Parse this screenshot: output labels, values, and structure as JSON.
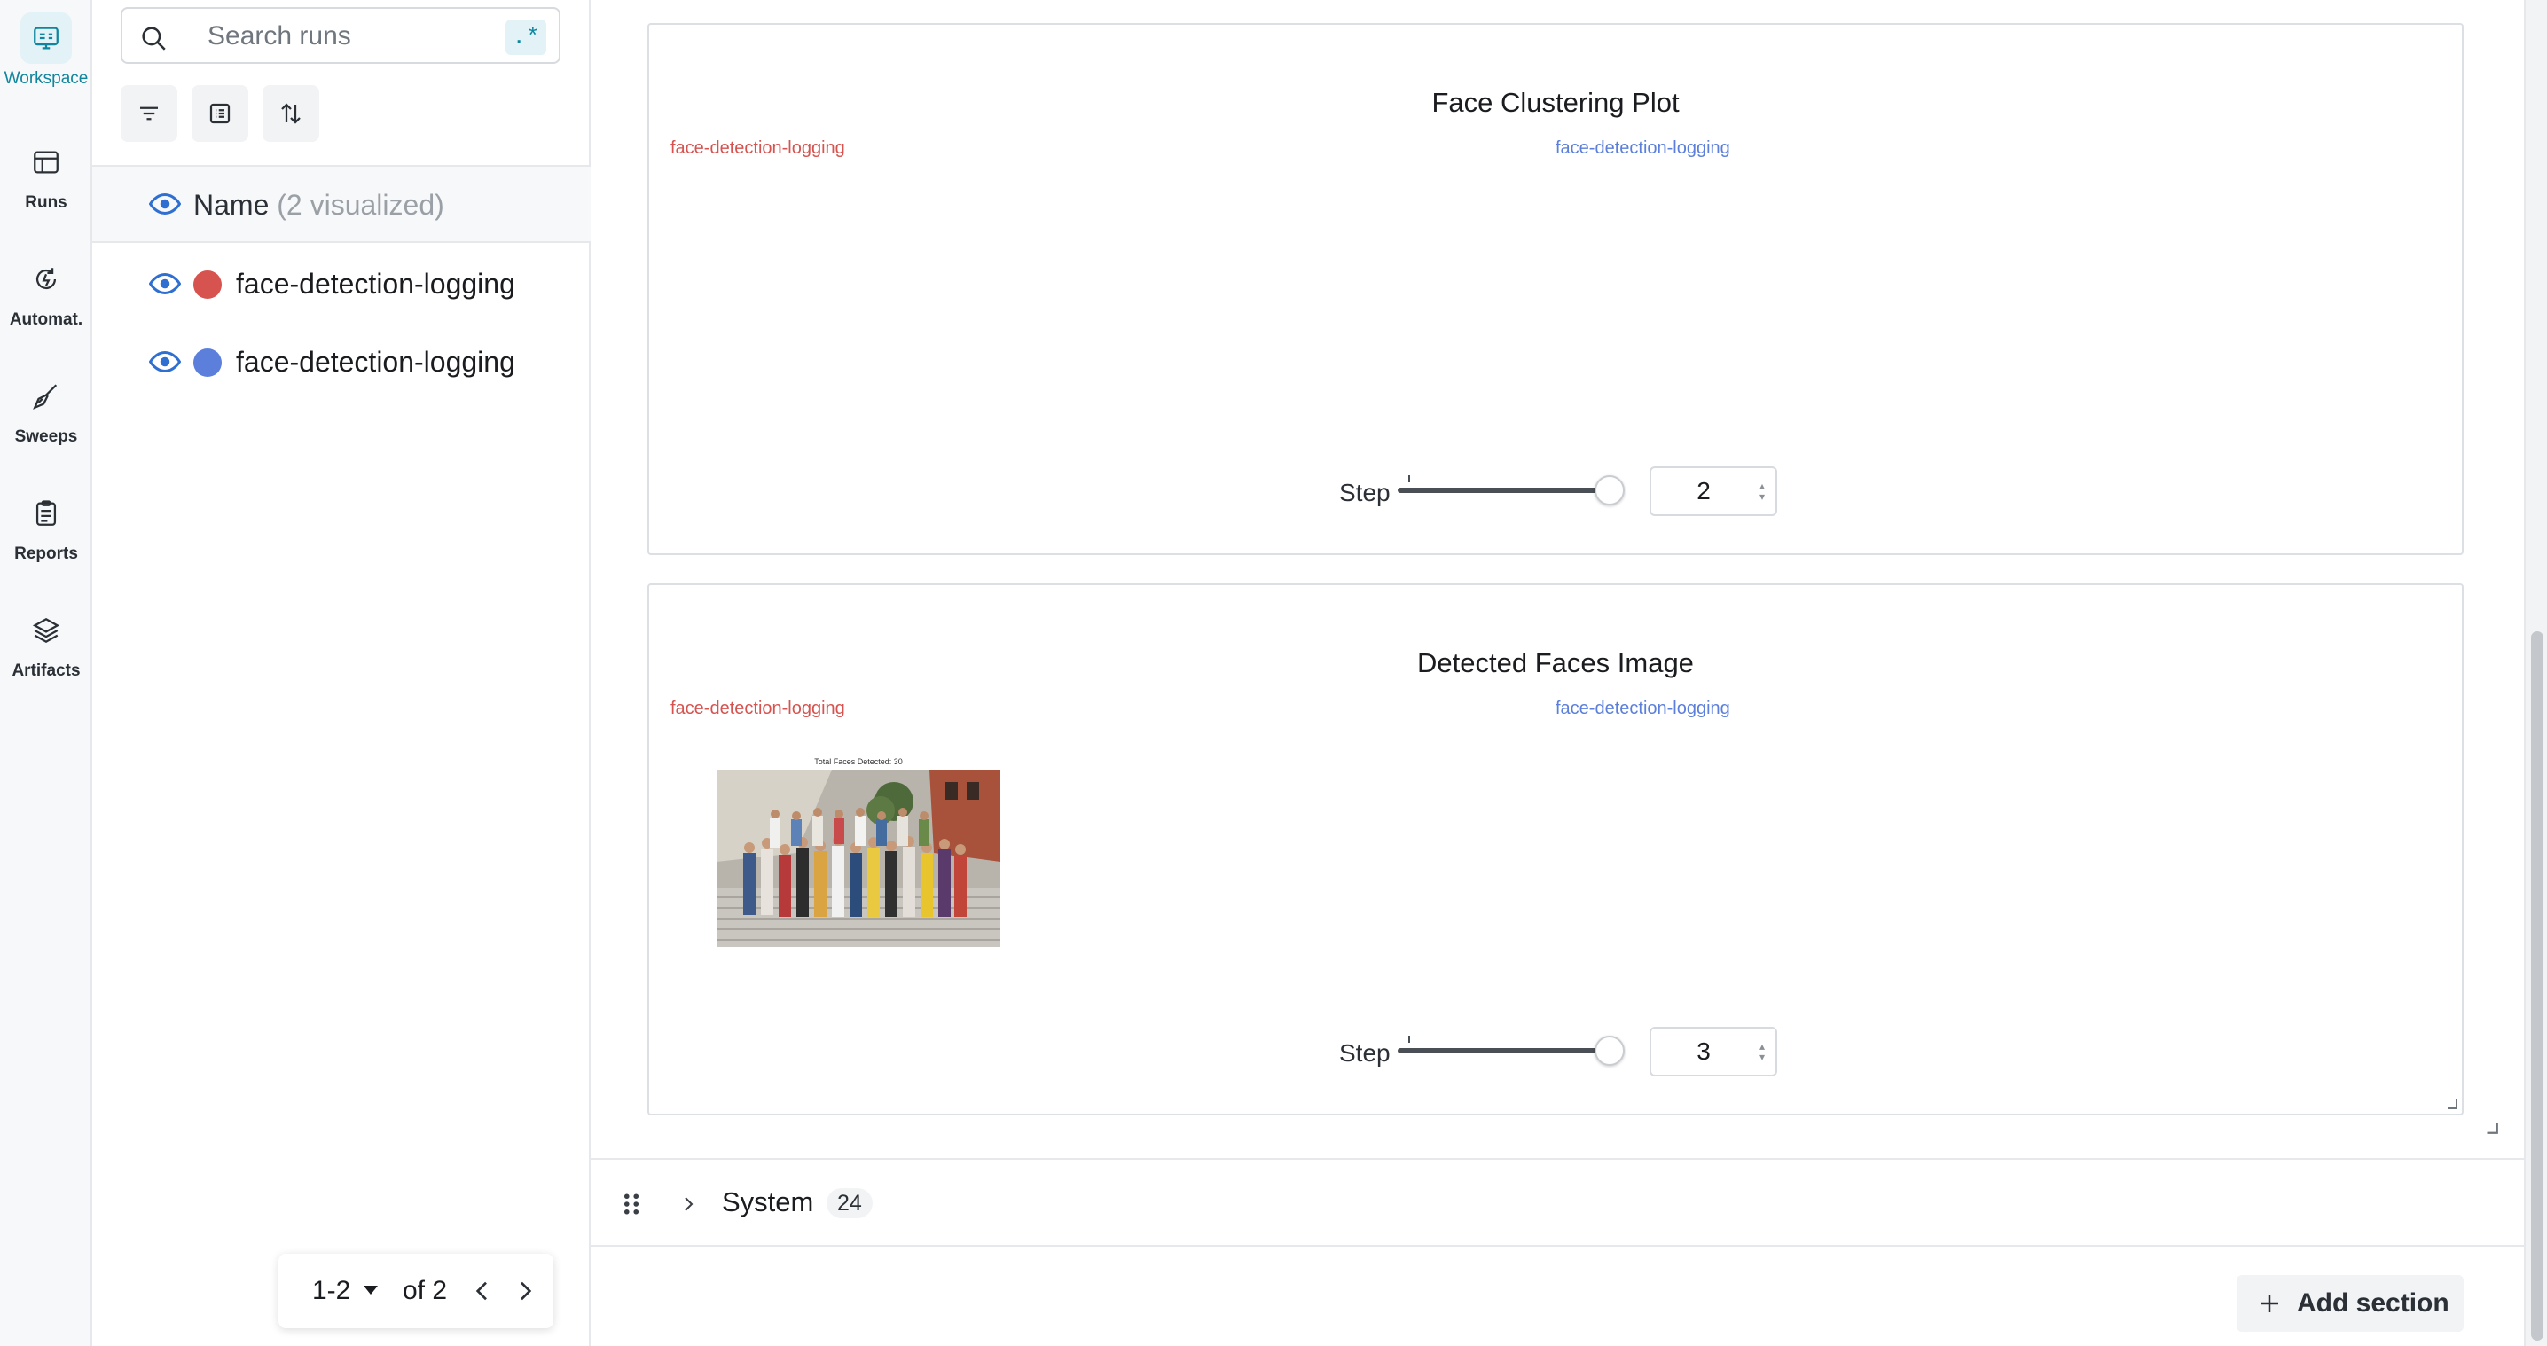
{
  "nav": {
    "items": [
      {
        "label": "Workspace",
        "icon": "workspace-icon",
        "active": true
      },
      {
        "label": "Runs",
        "icon": "runs-table-icon"
      },
      {
        "label": "Automat.",
        "icon": "automation-icon"
      },
      {
        "label": "Sweeps",
        "icon": "sweeps-broom-icon"
      },
      {
        "label": "Reports",
        "icon": "reports-clipboard-icon"
      },
      {
        "label": "Artifacts",
        "icon": "artifacts-layers-icon"
      }
    ]
  },
  "runs_panel": {
    "search_placeholder": "Search runs",
    "regex_label": ".*",
    "header_name": "Name",
    "header_count": "(2 visualized)",
    "runs": [
      {
        "name": "face-detection-logging",
        "color": "#d6534f"
      },
      {
        "name": "face-detection-logging",
        "color": "#5b7fdb"
      }
    ],
    "pagination": {
      "range": "1-2",
      "of": "of 2"
    }
  },
  "panels": [
    {
      "title": "Face Clustering Plot",
      "run_labels": [
        {
          "name": "face-detection-logging",
          "color": "#d6534f"
        },
        {
          "name": "face-detection-logging",
          "color": "#5b7fdb"
        }
      ],
      "step_label": "Step",
      "step_value": "2"
    },
    {
      "title": "Detected Faces Image",
      "run_labels": [
        {
          "name": "face-detection-logging",
          "color": "#d6534f"
        },
        {
          "name": "face-detection-logging",
          "color": "#5b7fdb"
        }
      ],
      "image_caption": "Total Faces Detected: 30",
      "step_label": "Step",
      "step_value": "3"
    }
  ],
  "system_section": {
    "name": "System",
    "count": "24"
  },
  "add_section_label": "Add section",
  "colors": {
    "accent": "#10869e",
    "run_red": "#d6534f",
    "run_blue": "#5b7fdb"
  }
}
